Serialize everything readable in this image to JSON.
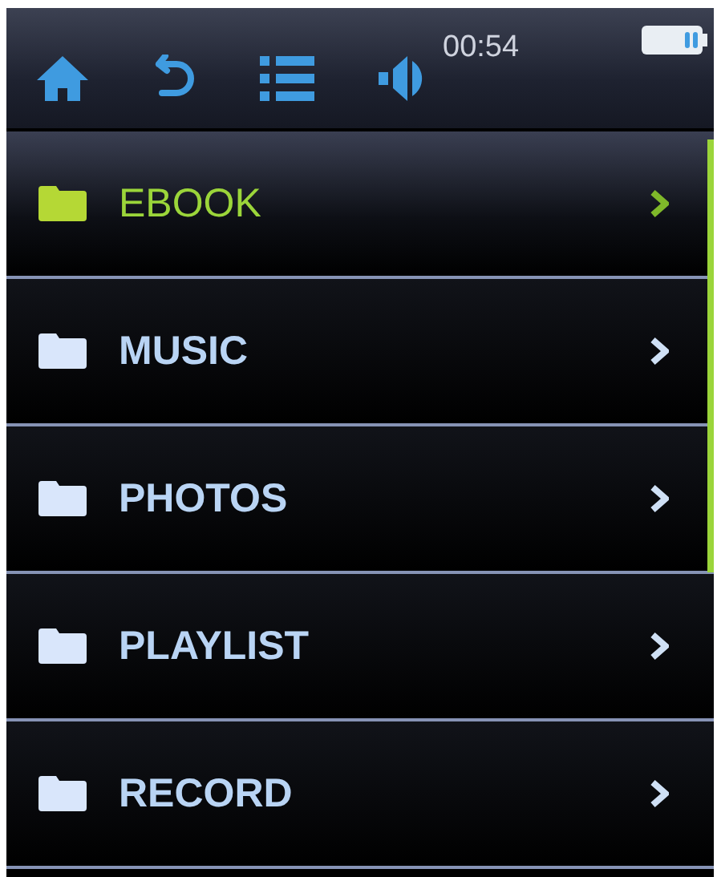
{
  "status_bar": {
    "time": "00:54"
  },
  "menu": {
    "items": [
      {
        "label": "EBOOK",
        "selected": true
      },
      {
        "label": "MUSIC",
        "selected": false
      },
      {
        "label": "PHOTOS",
        "selected": false
      },
      {
        "label": "PLAYLIST",
        "selected": false
      },
      {
        "label": "RECORD",
        "selected": false
      }
    ]
  }
}
